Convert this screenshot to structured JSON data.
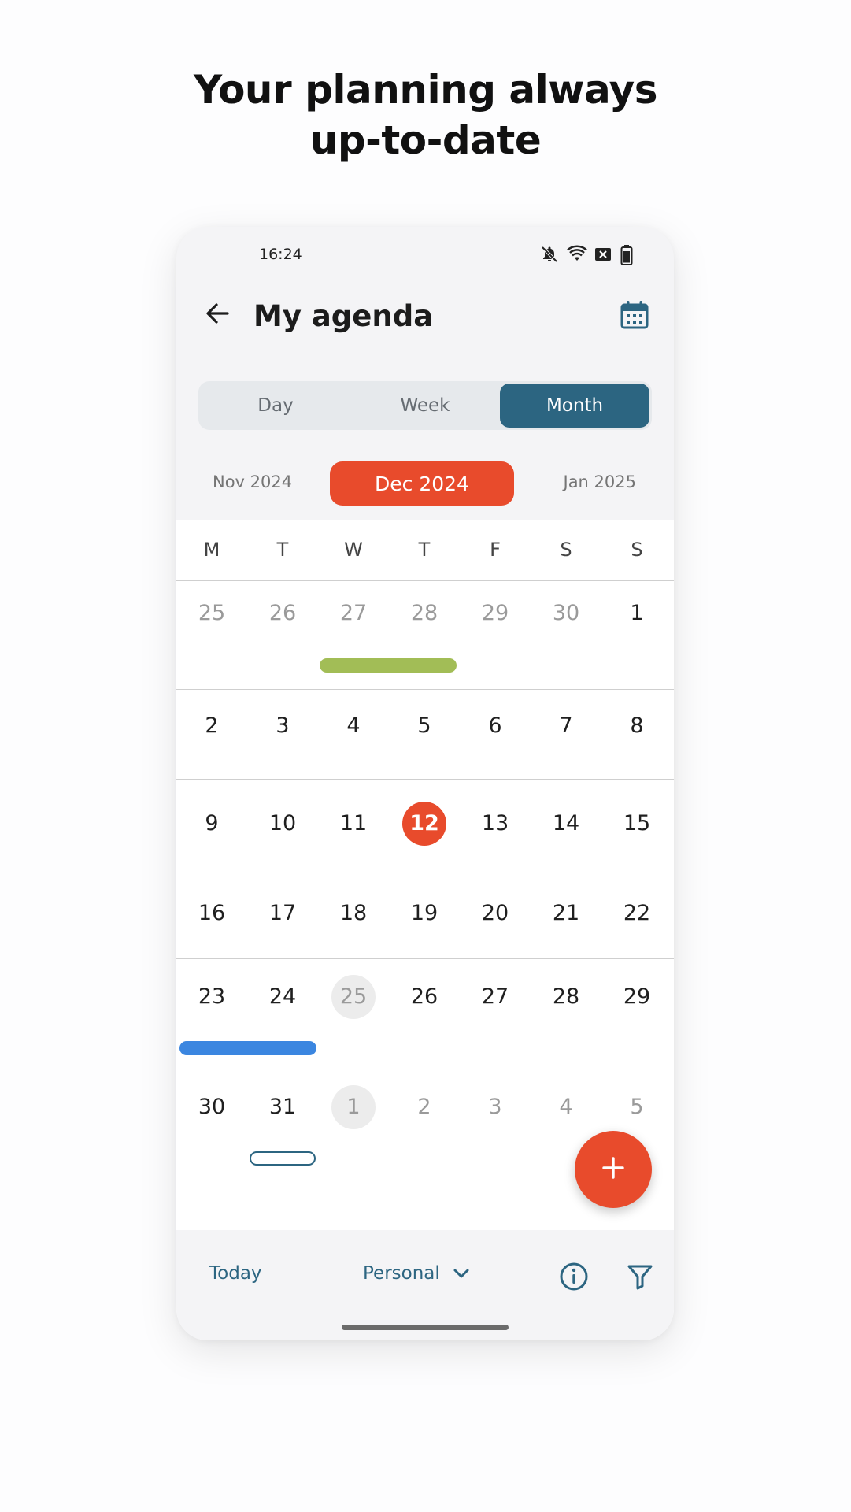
{
  "headline": {
    "line1": "Your planning always",
    "line2": "up-to-date"
  },
  "statusbar": {
    "time": "16:24",
    "icons": [
      "bell-off-icon",
      "wifi-icon",
      "no-sim-icon",
      "battery-icon"
    ]
  },
  "appbar": {
    "title": "My agenda",
    "back_icon": "arrow-left-icon",
    "calendar_icon": "calendar-icon"
  },
  "view_switch": {
    "options": [
      "Day",
      "Week",
      "Month"
    ],
    "selected": "Month"
  },
  "month_nav": {
    "prev": "Nov 2024",
    "current": "Dec 2024",
    "next": "Jan 2025"
  },
  "calendar": {
    "weekdays": [
      "M",
      "T",
      "W",
      "T",
      "F",
      "S",
      "S"
    ],
    "weeks": [
      {
        "days": [
          "25",
          "26",
          "27",
          "28",
          "29",
          "30",
          "1"
        ]
      },
      {
        "days": [
          "2",
          "3",
          "4",
          "5",
          "6",
          "7",
          "8"
        ]
      },
      {
        "days": [
          "9",
          "10",
          "11",
          "12",
          "13",
          "14",
          "15"
        ]
      },
      {
        "days": [
          "16",
          "17",
          "18",
          "19",
          "20",
          "21",
          "22"
        ]
      },
      {
        "days": [
          "23",
          "24",
          "25",
          "26",
          "27",
          "28",
          "29"
        ]
      },
      {
        "days": [
          "30",
          "31",
          "1",
          "2",
          "3",
          "4",
          "5"
        ]
      }
    ],
    "today": "12",
    "colors": {
      "today": "#e84b2c",
      "holiday_highlight": "#ececec",
      "event_green": "#a2bd56",
      "event_blue": "#3b86e0",
      "event_outline": "#2c6581"
    }
  },
  "fab": {
    "icon": "plus-icon"
  },
  "bottombar": {
    "today_label": "Today",
    "calendar_label": "Personal",
    "dropdown_icon": "chevron-down-icon",
    "info_icon": "info-icon",
    "filter_icon": "filter-icon"
  },
  "colors": {
    "primary": "#2c6581",
    "accent": "#e84b2c"
  }
}
